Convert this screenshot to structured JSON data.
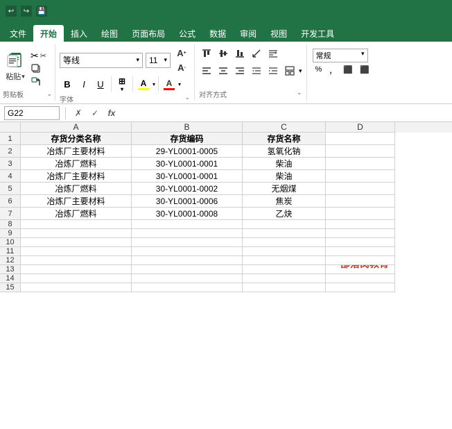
{
  "titleBar": {
    "undo": "↩",
    "redo": "↪",
    "save": "💾"
  },
  "tabs": [
    {
      "label": "文件",
      "active": false
    },
    {
      "label": "开始",
      "active": true
    },
    {
      "label": "插入",
      "active": false
    },
    {
      "label": "绘图",
      "active": false
    },
    {
      "label": "页面布局",
      "active": false
    },
    {
      "label": "公式",
      "active": false
    },
    {
      "label": "数据",
      "active": false
    },
    {
      "label": "审阅",
      "active": false
    },
    {
      "label": "视图",
      "active": false
    },
    {
      "label": "开发工具",
      "active": false
    }
  ],
  "ribbon": {
    "clipboard": {
      "label": "剪贴板",
      "paste": "粘贴",
      "cut": "✂",
      "copy": "⧉",
      "format_painter": "🖌"
    },
    "font": {
      "label": "字体",
      "name": "等线",
      "size": "11",
      "bold": "B",
      "italic": "I",
      "underline": "U",
      "border": "⊞",
      "fill_color": "A",
      "font_color": "A",
      "expand": "⌄"
    },
    "alignment": {
      "label": "对齐方式",
      "expand": "⌄"
    }
  },
  "formulaBar": {
    "cellRef": "G22",
    "cancelBtn": "✗",
    "confirmBtn": "✓",
    "functionBtn": "fx",
    "formula": ""
  },
  "columns": [
    {
      "label": "",
      "key": "row"
    },
    {
      "label": "A",
      "key": "a"
    },
    {
      "label": "B",
      "key": "b"
    },
    {
      "label": "C",
      "key": "c"
    },
    {
      "label": "D",
      "key": "d"
    }
  ],
  "rows": [
    {
      "num": "1",
      "a": "存货分类名称",
      "b": "存货编码",
      "c": "存货名称",
      "d": "",
      "isHeader": true
    },
    {
      "num": "2",
      "a": "冶炼厂主要材料",
      "b": "29-YL0001-0005",
      "c": "氢氧化钠",
      "d": ""
    },
    {
      "num": "3",
      "a": "冶炼厂燃料",
      "b": "30-YL0001-0001",
      "c": "柴油",
      "d": ""
    },
    {
      "num": "4",
      "a": "冶炼厂主要材料",
      "b": "30-YL0001-0001",
      "c": "柴油",
      "d": ""
    },
    {
      "num": "5",
      "a": "冶炼厂燃料",
      "b": "30-YL0001-0002",
      "c": "无烟煤",
      "d": ""
    },
    {
      "num": "6",
      "a": "冶炼厂主要材料",
      "b": "30-YL0001-0006",
      "c": "焦炭",
      "d": ""
    },
    {
      "num": "7",
      "a": "冶炼厂燃料",
      "b": "30-YL0001-0008",
      "c": "乙炔",
      "d": ""
    },
    {
      "num": "8",
      "a": "",
      "b": "",
      "c": "",
      "d": ""
    },
    {
      "num": "9",
      "a": "",
      "b": "",
      "c": "",
      "d": ""
    },
    {
      "num": "10",
      "a": "",
      "b": "",
      "c": "",
      "d": ""
    },
    {
      "num": "11",
      "a": "",
      "b": "",
      "c": "",
      "d": ""
    },
    {
      "num": "12",
      "a": "",
      "b": "",
      "c": "",
      "d": ""
    },
    {
      "num": "13",
      "a": "",
      "b": "",
      "c": "",
      "d": ""
    },
    {
      "num": "14",
      "a": "",
      "b": "",
      "c": "",
      "d": ""
    },
    {
      "num": "15",
      "a": "",
      "b": "",
      "c": "",
      "d": ""
    }
  ],
  "watermark": "部落窝教育"
}
